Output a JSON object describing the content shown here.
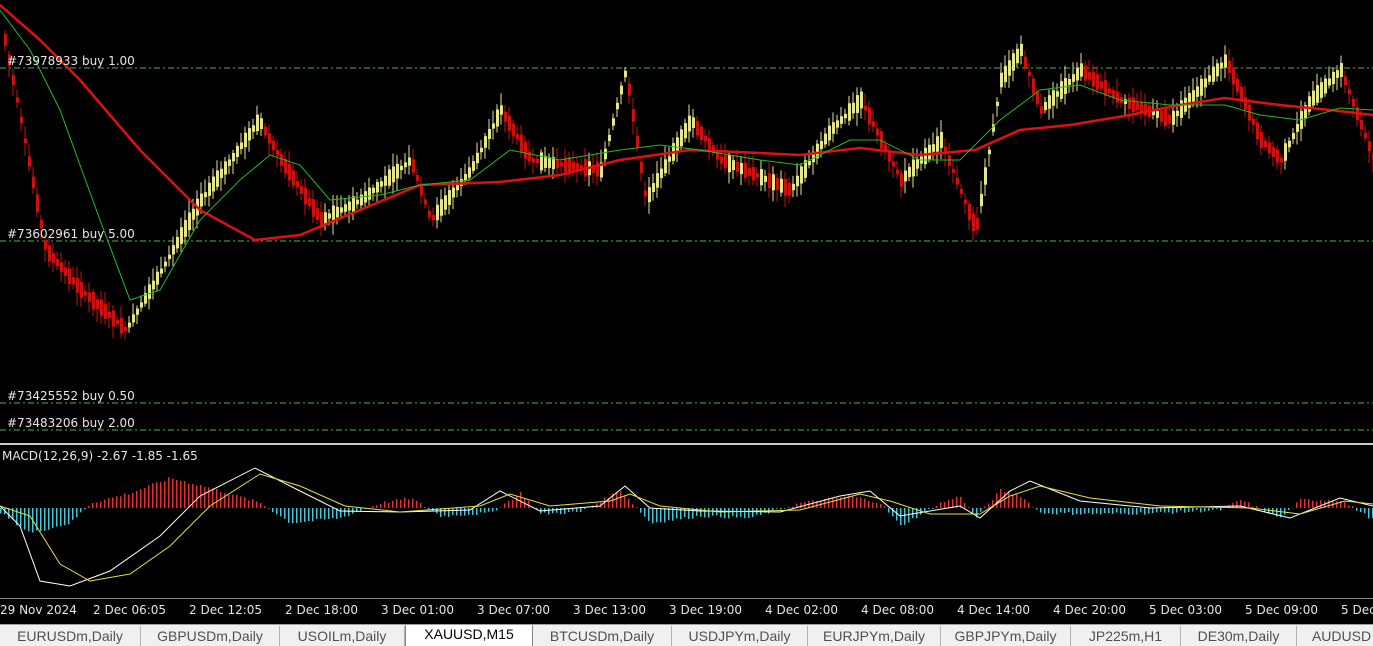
{
  "symbol": "XAUUSD,M15",
  "orders": [
    {
      "label": "#73978933 buy 1.00",
      "price_line": "green-dash"
    },
    {
      "label": "#73602961 buy 5.00",
      "price_line": "green-dash"
    },
    {
      "label": "#73425552 buy 0.50",
      "price_line": "green-dash"
    },
    {
      "label": "#73483206 buy 2.00",
      "price_line": "green-dash"
    }
  ],
  "macd": {
    "label": "MACD(12,26,9) -2.67 -1.85 -1.65"
  },
  "time_axis": [
    "29 Nov 2024",
    "2 Dec 06:05",
    "2 Dec 12:05",
    "2 Dec 18:00",
    "3 Dec 01:00",
    "3 Dec 07:00",
    "3 Dec 13:00",
    "3 Dec 19:00",
    "4 Dec 02:00",
    "4 Dec 08:00",
    "4 Dec 14:00",
    "4 Dec 20:00",
    "5 Dec 03:00",
    "5 Dec 09:00",
    "5 Dec"
  ],
  "tabs": [
    "EURUSDm,Daily",
    "GBPUSDm,Daily",
    "USOILm,Daily",
    "XAUUSD,M15",
    "BTCUSDm,Daily",
    "USDJPYm,Daily",
    "EURJPYm,Daily",
    "GBPJPYm,Daily",
    "JP225m,H1",
    "DE30m,Daily",
    "AUDUSD"
  ],
  "active_tab": "XAUUSD,M15",
  "colors": {
    "background": "#000000",
    "bull_candle": "#e6e68c",
    "bear_candle": "#cc1010",
    "ma_slow": "#e01010",
    "ma_fast": "#22bb22",
    "order_line": "#4caf50",
    "macd_pos": "#e03030",
    "macd_neg": "#40c8d8",
    "macd_line": "#ffffff",
    "signal_line": "#e8e040"
  }
}
